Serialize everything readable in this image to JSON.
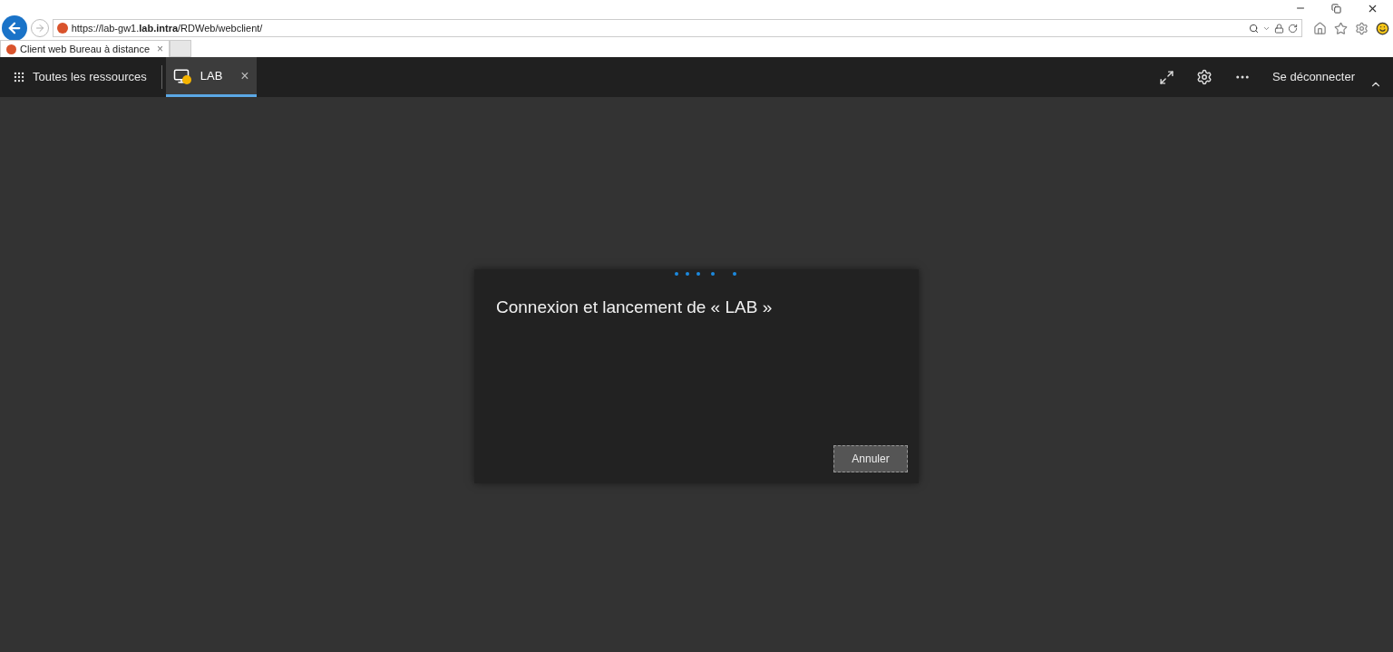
{
  "browser": {
    "url": "https://lab-gw1.**lab.intra**/RDWeb/webclient/",
    "tab_title": "Client web Bureau à distance",
    "tab_close": "×"
  },
  "app_bar": {
    "all_resources": "Toutes les ressources",
    "tabs": [
      {
        "label": "LAB",
        "selected": true,
        "close": "×"
      }
    ],
    "sign_out": "Se déconnecter"
  },
  "dialog": {
    "title": "Connexion et lancement de « LAB »",
    "cancel": "Annuler"
  }
}
